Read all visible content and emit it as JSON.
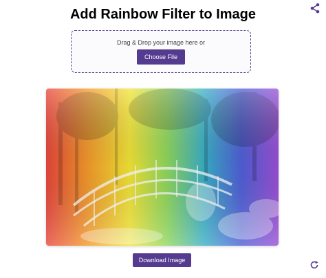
{
  "header": {
    "title": "Add Rainbow Filter to Image"
  },
  "upload": {
    "prompt": "Drag & Drop your image here or",
    "choose_label": "Choose File"
  },
  "actions": {
    "download_label": "Download Image"
  },
  "icons": {
    "share": "share-icon",
    "refresh": "refresh-icon"
  },
  "colors": {
    "accent": "#553b8f",
    "dropzone_border": "#5b3f8f",
    "background": "#ffffff"
  }
}
